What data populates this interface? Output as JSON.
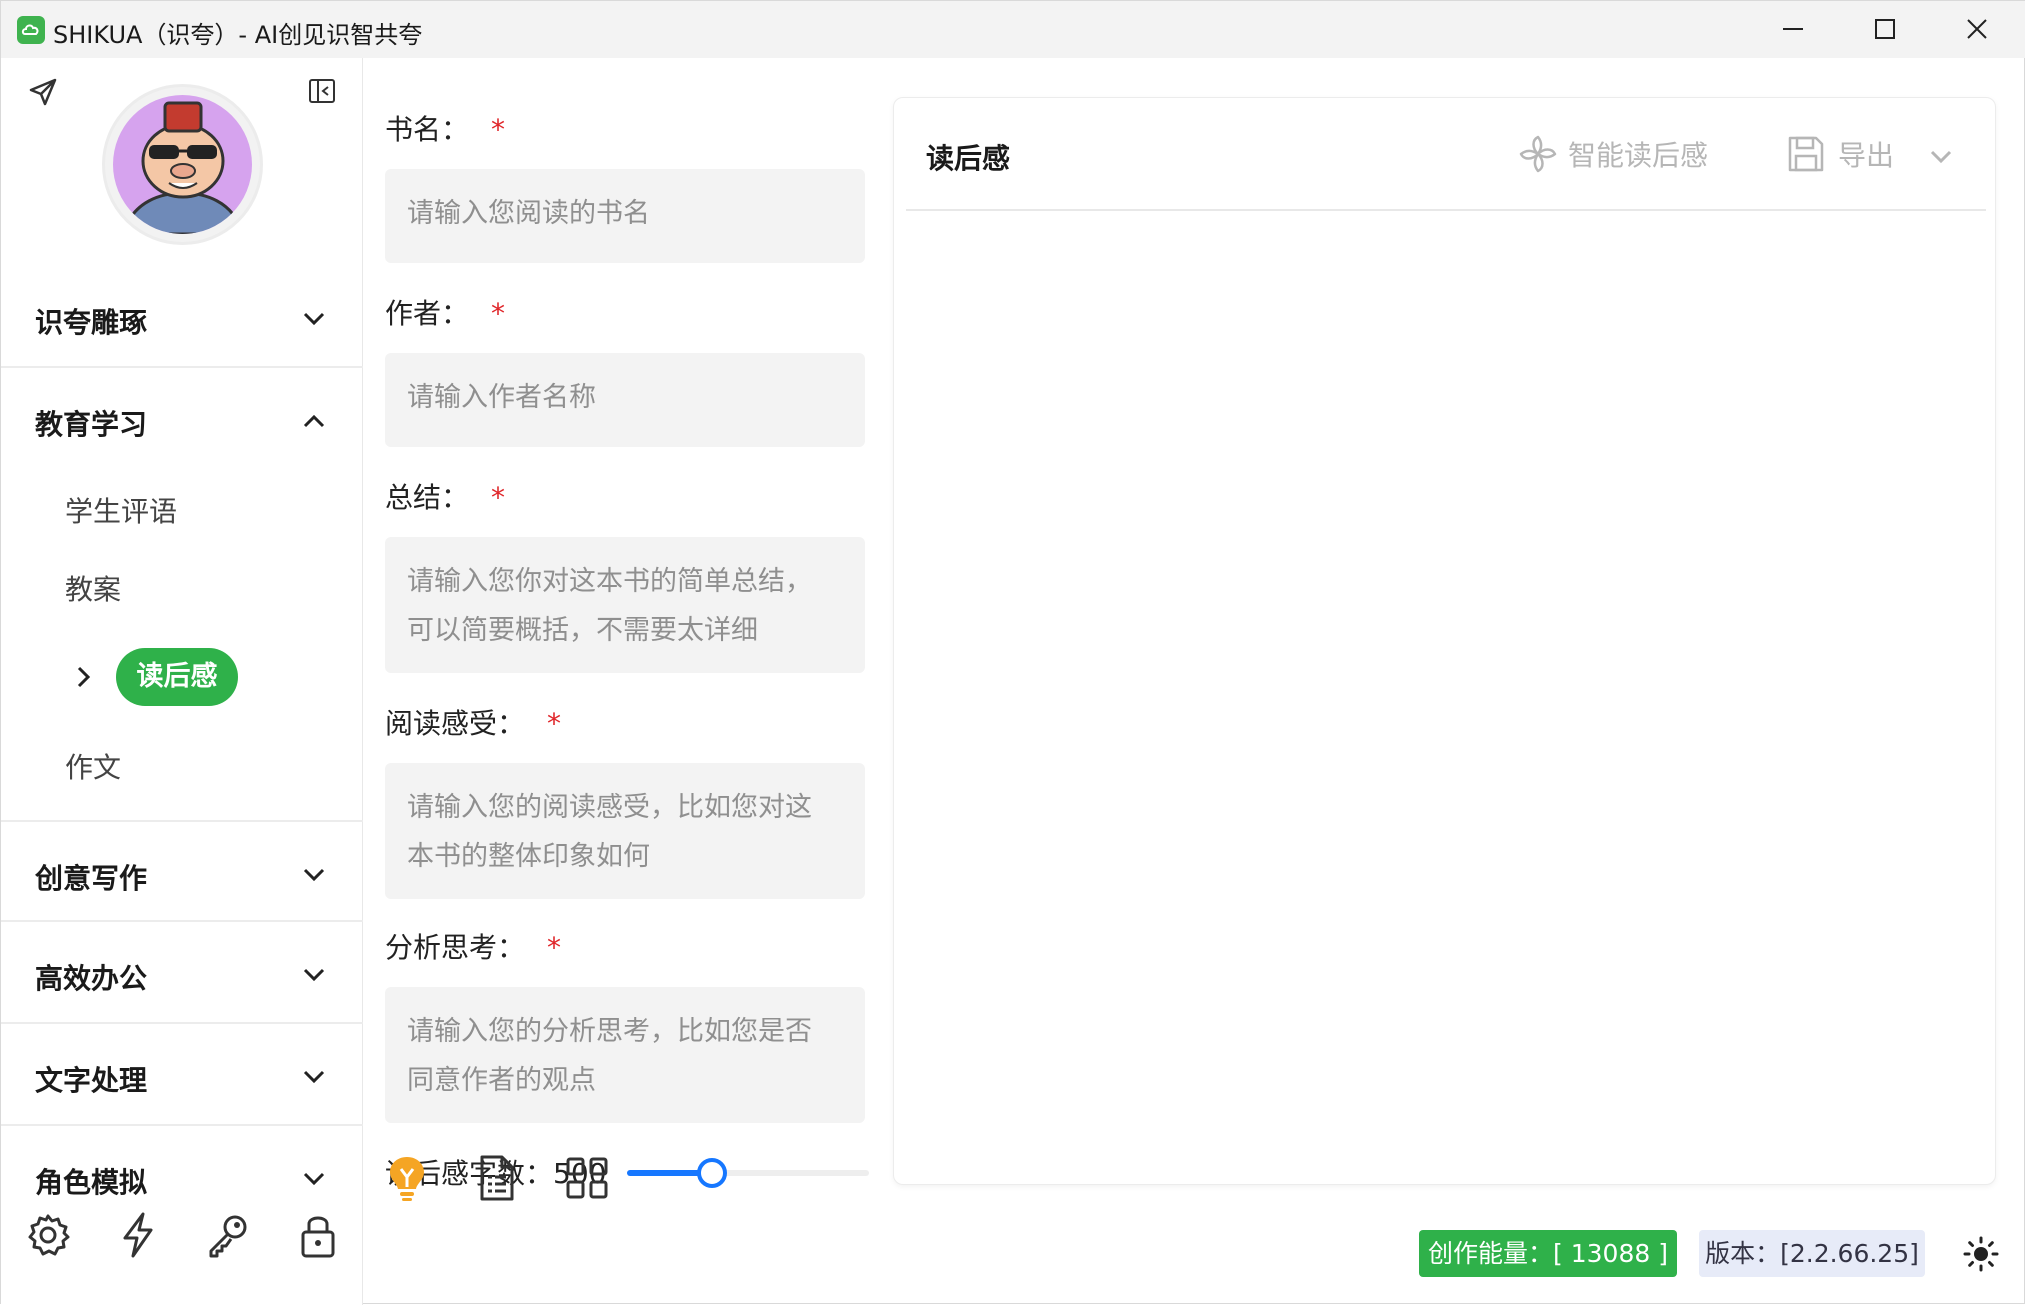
{
  "window": {
    "title": "SHIKUA（识夸）- AI创见识智共夸"
  },
  "sidebar": {
    "categories": [
      {
        "label": "识夸雕琢",
        "expanded": false
      },
      {
        "label": "教育学习",
        "expanded": true
      },
      {
        "label": "创意写作",
        "expanded": false
      },
      {
        "label": "高效办公",
        "expanded": false
      },
      {
        "label": "文字处理",
        "expanded": false
      },
      {
        "label": "角色模拟",
        "expanded": false
      }
    ],
    "sub_items": [
      "学生评语",
      "教案",
      "读后感",
      "作文"
    ],
    "active_item": "读后感",
    "tools": [
      "settings-icon",
      "lightning-icon",
      "key-icon",
      "lock-icon"
    ]
  },
  "form": {
    "fields": [
      {
        "label": "书名：",
        "required_mark": "*",
        "placeholder": "请输入您阅读的书名"
      },
      {
        "label": "作者：",
        "required_mark": "*",
        "placeholder": "请输入作者名称"
      },
      {
        "label": "总结：",
        "required_mark": "*",
        "placeholder_lines": [
          "请输入您你对这本书的简单总结，",
          "可以简要概括，不需要太详细"
        ]
      },
      {
        "label": "阅读感受：",
        "required_mark": "*",
        "placeholder_lines": [
          "请输入您的阅读感受，比如您对这",
          "本书的整体印象如何"
        ]
      },
      {
        "label": "分析思考：",
        "required_mark": "*",
        "placeholder_lines": [
          "请输入您的分析思考，比如您是否",
          "同意作者的观点"
        ]
      }
    ],
    "slider": {
      "label": "读后感字数：",
      "value": "500",
      "fraction": 0.35
    },
    "tools": [
      "bulb-icon",
      "document-icon",
      "grid-icon"
    ]
  },
  "panel": {
    "title": "读后感",
    "generate_label": "智能读后感",
    "export_label": "导出"
  },
  "status": {
    "energy": "创作能量：[ 13088 ]",
    "version": "版本：[2.2.66.25]"
  },
  "colors": {
    "accent_green": "#2fb14a",
    "slider_blue": "#1677ff",
    "required_red": "#e0262a"
  }
}
